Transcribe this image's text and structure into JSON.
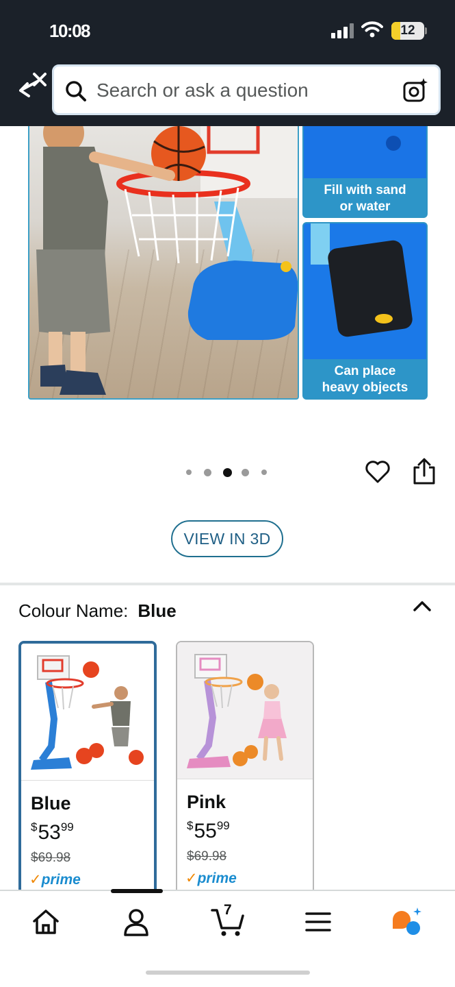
{
  "status_bar": {
    "time": "10:08",
    "battery": "12"
  },
  "search": {
    "placeholder": "Search or ask a question"
  },
  "gallery": {
    "captions": {
      "fill": "Fill with sand or water",
      "heavy": "Can place heavy objects"
    },
    "dots_count": 5,
    "active_dot": 2
  },
  "view_3d_label": "VIEW IN 3D",
  "colour": {
    "label": "Colour Name:",
    "selected": "Blue"
  },
  "options": [
    {
      "name": "Blue",
      "price_symbol": "$",
      "price_whole": "53",
      "price_cents": "99",
      "was_price": "$69.98",
      "prime_label": "prime",
      "accent": "#2b7fd6"
    },
    {
      "name": "Pink",
      "price_symbol": "$",
      "price_whole": "55",
      "price_cents": "99",
      "was_price": "$69.98",
      "prime_label": "prime",
      "accent": "#e58cc1"
    }
  ],
  "nav": {
    "cart_count": "7",
    "items": [
      "home-icon",
      "account-icon",
      "cart-icon",
      "menu-icon",
      "rufus-icon"
    ]
  },
  "colors": {
    "header_bg": "#1b2129",
    "link_blue": "#1f5f85",
    "selected_border": "#2f6b9a",
    "prime_blue": "#1a8ccf",
    "prime_check": "#f08804",
    "rufus_orange": "#f57c1f",
    "rufus_blue": "#1f8ee6"
  }
}
